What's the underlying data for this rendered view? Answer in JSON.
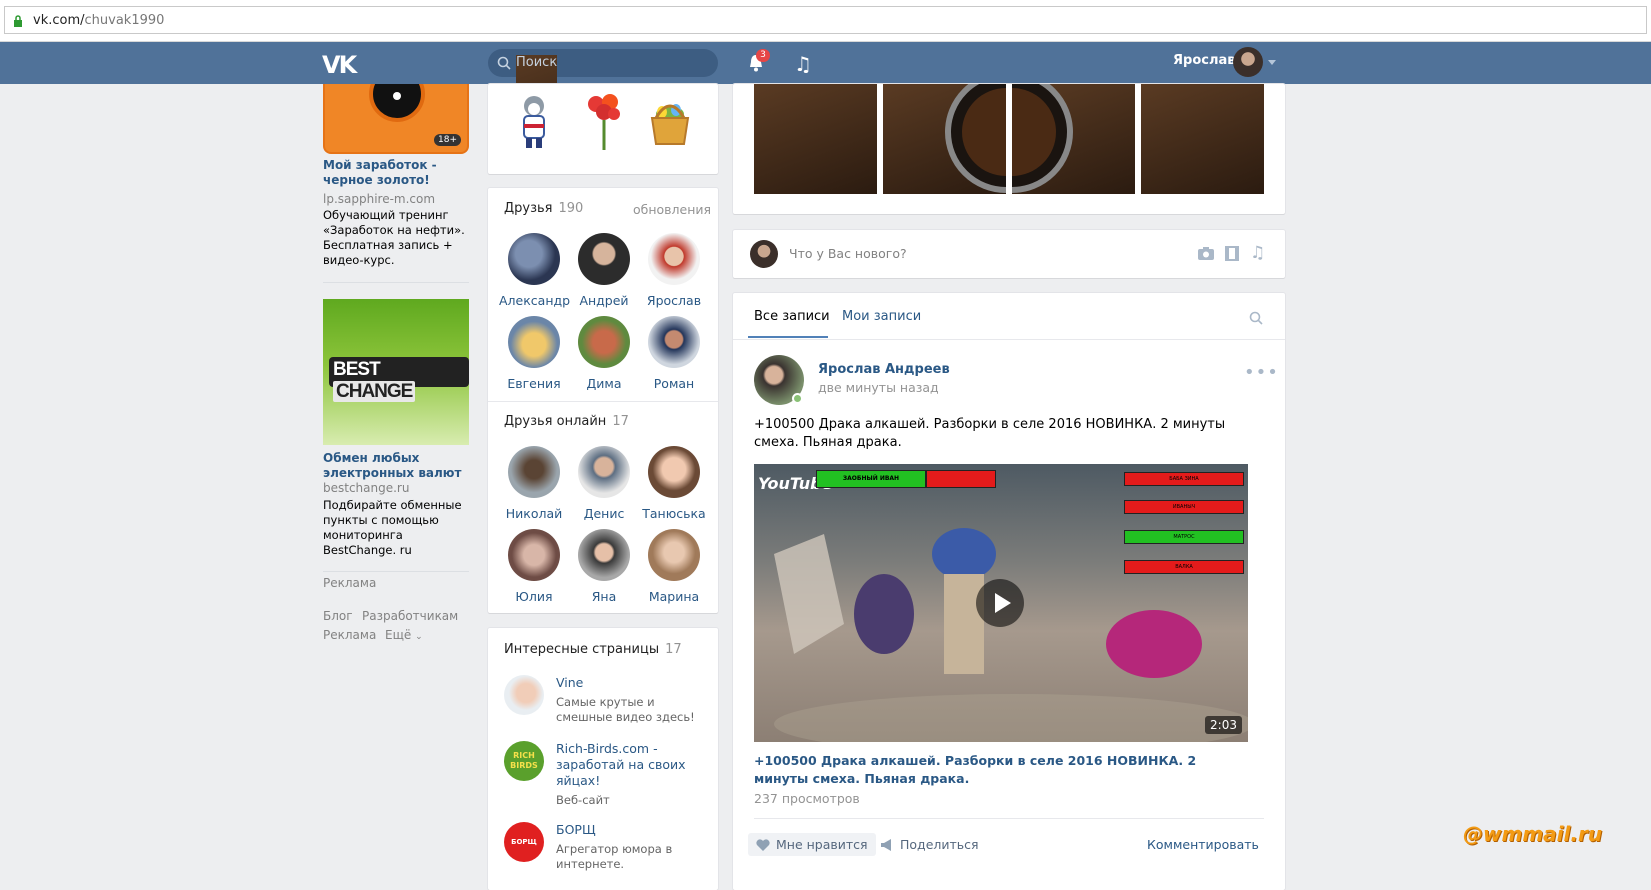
{
  "browser": {
    "url_domain": "vk.com/",
    "url_path": "chuvak1990"
  },
  "header": {
    "logo": "VK",
    "search_placeholder": "Поиск",
    "notifications_count": "3",
    "user_name": "Ярослав"
  },
  "ads": [
    {
      "title": "Мой заработок - черное золото!",
      "domain": "lp.sapphire-m.com",
      "text": "Обучающий тренинг «Заработок на нефти». Бесплатная запись + видео-курс.",
      "age_label": "18+"
    },
    {
      "brand": "BEST",
      "brand2": "CHANGE",
      "title": "Обмен любых электронных валют",
      "domain": "bestchange.ru",
      "text": "Подбирайте обменные пункты с помощью мониторинга BestChange. ru"
    }
  ],
  "ads_label": "Реклама",
  "footer_links": {
    "blog": "Блог",
    "dev": "Разработчикам",
    "ads": "Реклама",
    "more": "Ещё"
  },
  "friends": {
    "title": "Друзья",
    "count": "190",
    "link": "обновления",
    "items": [
      {
        "name": "Александр"
      },
      {
        "name": "Андрей"
      },
      {
        "name": "Ярослав"
      },
      {
        "name": "Евгения"
      },
      {
        "name": "Дима"
      },
      {
        "name": "Роман"
      }
    ]
  },
  "friends_online": {
    "title": "Друзья онлайн",
    "count": "17",
    "items": [
      {
        "name": "Николай"
      },
      {
        "name": "Денис"
      },
      {
        "name": "Танюська"
      },
      {
        "name": "Юлия"
      },
      {
        "name": "Яна"
      },
      {
        "name": "Марина"
      }
    ]
  },
  "pages": {
    "title": "Интересные страницы",
    "count": "17",
    "items": [
      {
        "name": "Vine",
        "desc": "Самые крутые и смешные видео здесь!",
        "extra": ""
      },
      {
        "name": "Rich-Birds.com - заработай на своих яйцах!",
        "desc": "",
        "extra": "Веб-сайт"
      },
      {
        "name": "БОРЩ",
        "desc": "Агрегатор юмора в интернете.",
        "extra": ""
      }
    ],
    "icon_labels": {
      "rich": "RICH BIRDS",
      "borsch": "БОРЩ"
    }
  },
  "new_post": {
    "placeholder": "Что у Вас нового?"
  },
  "wall": {
    "tab_all": "Все записи",
    "tab_mine": "Мои записи"
  },
  "post": {
    "author": "Ярослав Андреев",
    "time": "две минуты назад",
    "text": "+100500 Драка алкашей. Разборки в селе 2016 НОВИНКА. 2 минуты смеха. Пьяная драка.",
    "video_duration": "2:03",
    "video_title": "+100500 Драка алкашей. Разборки в селе 2016 НОВИНКА. 2 минуты смеха. Пьяная драка.",
    "views": "237 просмотров",
    "like": "Мне нравится",
    "share": "Поделиться",
    "comment": "Комментировать",
    "video_overlay_logo": "YouTube",
    "video_bar_labels": [
      "ЗАОБНЫЙ ИВАН",
      "БАБА ЗИНА",
      "ИВАНЫЧ",
      "МАТРОС",
      "ВАЛКА"
    ]
  },
  "watermark": "@wmmail.ru",
  "colors": {
    "header": "#507299",
    "link": "#2a5885",
    "bg": "#edeef0"
  }
}
